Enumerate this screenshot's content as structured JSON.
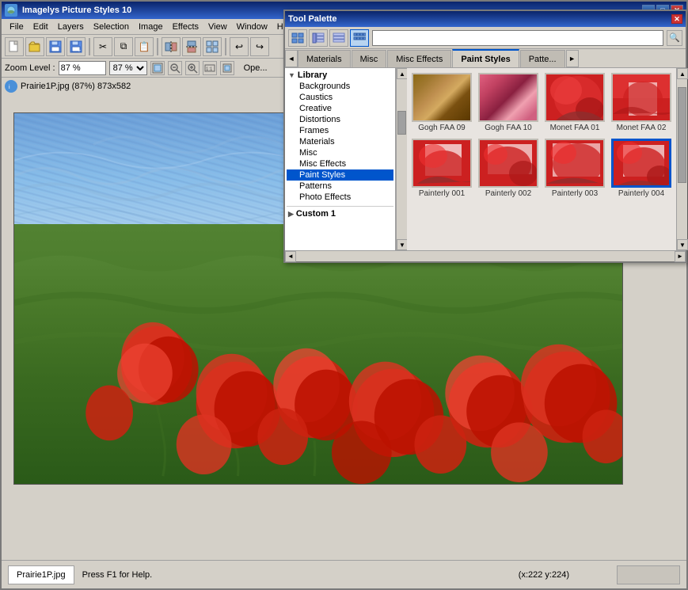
{
  "app": {
    "title": "Imagelys Picture Styles 10",
    "file_info": "Prairie1P.jpg (87%) 873x582"
  },
  "toolbar": {
    "zoom_label": "Zoom Level :",
    "zoom_value": "87 %",
    "open_label": "Ope..."
  },
  "menu": {
    "items": [
      "File",
      "Edit",
      "Layers",
      "Selection",
      "Image",
      "Effects",
      "View",
      "Window",
      "H"
    ]
  },
  "file_bar": {
    "filename": "Prairie1P.jpg (87%) 873x582"
  },
  "status_bar": {
    "tab_label": "Prairie1P.jpg",
    "help_text": "Press F1 for Help.",
    "coords": "(x:222 y:224)"
  },
  "tool_palette": {
    "title": "Tool Palette",
    "tabs": [
      "Materials",
      "Misc",
      "Misc Effects",
      "Paint Styles",
      "Patte..."
    ],
    "active_tab": "Paint Styles",
    "library": {
      "header": "Library",
      "items": [
        "Backgrounds",
        "Caustics",
        "Creative",
        "Distortions",
        "Frames",
        "Materials",
        "Misc",
        "Misc Effects",
        "Paint Styles",
        "Patterns",
        "Photo Effects"
      ],
      "selected": "Paint Styles",
      "footer": "Custom 1"
    },
    "thumbnails": {
      "row1": [
        {
          "id": "gogh09",
          "label": "Gogh FAA 09",
          "style": "thumb-gogh09"
        },
        {
          "id": "gogh10",
          "label": "Gogh FAA 10",
          "style": "thumb-gogh10"
        },
        {
          "id": "monet01",
          "label": "Monet FAA 01",
          "style": "thumb-monet01"
        },
        {
          "id": "monet02",
          "label": "Monet FAA 02",
          "style": "thumb-monet02"
        }
      ],
      "row2": [
        {
          "id": "painterly001",
          "label": "Painterly 001",
          "style": "thumb-painterly001"
        },
        {
          "id": "painterly002",
          "label": "Painterly 002",
          "style": "thumb-painterly002"
        },
        {
          "id": "painterly003",
          "label": "Painterly 003",
          "style": "thumb-painterly003"
        },
        {
          "id": "painterly004",
          "label": "Painterly 004",
          "style": "thumb-painterly004",
          "selected": true
        }
      ]
    }
  },
  "colors": {
    "title_bar_start": "#0a246a",
    "title_bar_end": "#3366cc",
    "active_tab_border": "#0055cc",
    "selected_item_bg": "#0055cc",
    "window_bg": "#d4d0c8"
  },
  "icons": {
    "new": "📄",
    "open": "📂",
    "save": "💾",
    "copy": "⧉",
    "paste": "📋",
    "undo": "↩",
    "redo": "↪",
    "zoom_in": "🔍",
    "zoom_out": "🔎",
    "search": "🔍",
    "expand": "▶",
    "collapse": "▼",
    "arrow_up": "▲",
    "arrow_down": "▼",
    "arrow_left": "◄",
    "arrow_right": "►",
    "close": "✕"
  }
}
